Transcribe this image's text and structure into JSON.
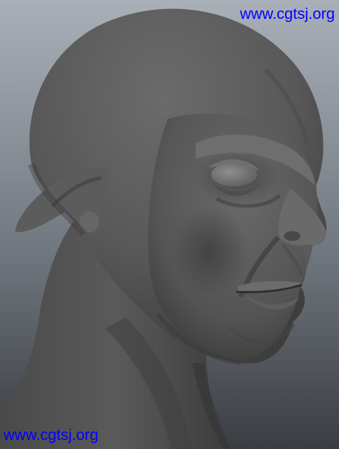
{
  "watermark": {
    "top_text": "www.cgtsj.org",
    "bottom_text": "www.cgtsj.org",
    "color": "#0000ff"
  },
  "scene": {
    "subject": "sculpted-head-model",
    "background_top_color": "#a9b0b8",
    "background_bottom_color": "#3c3f44",
    "model_base_color": "#555555"
  }
}
